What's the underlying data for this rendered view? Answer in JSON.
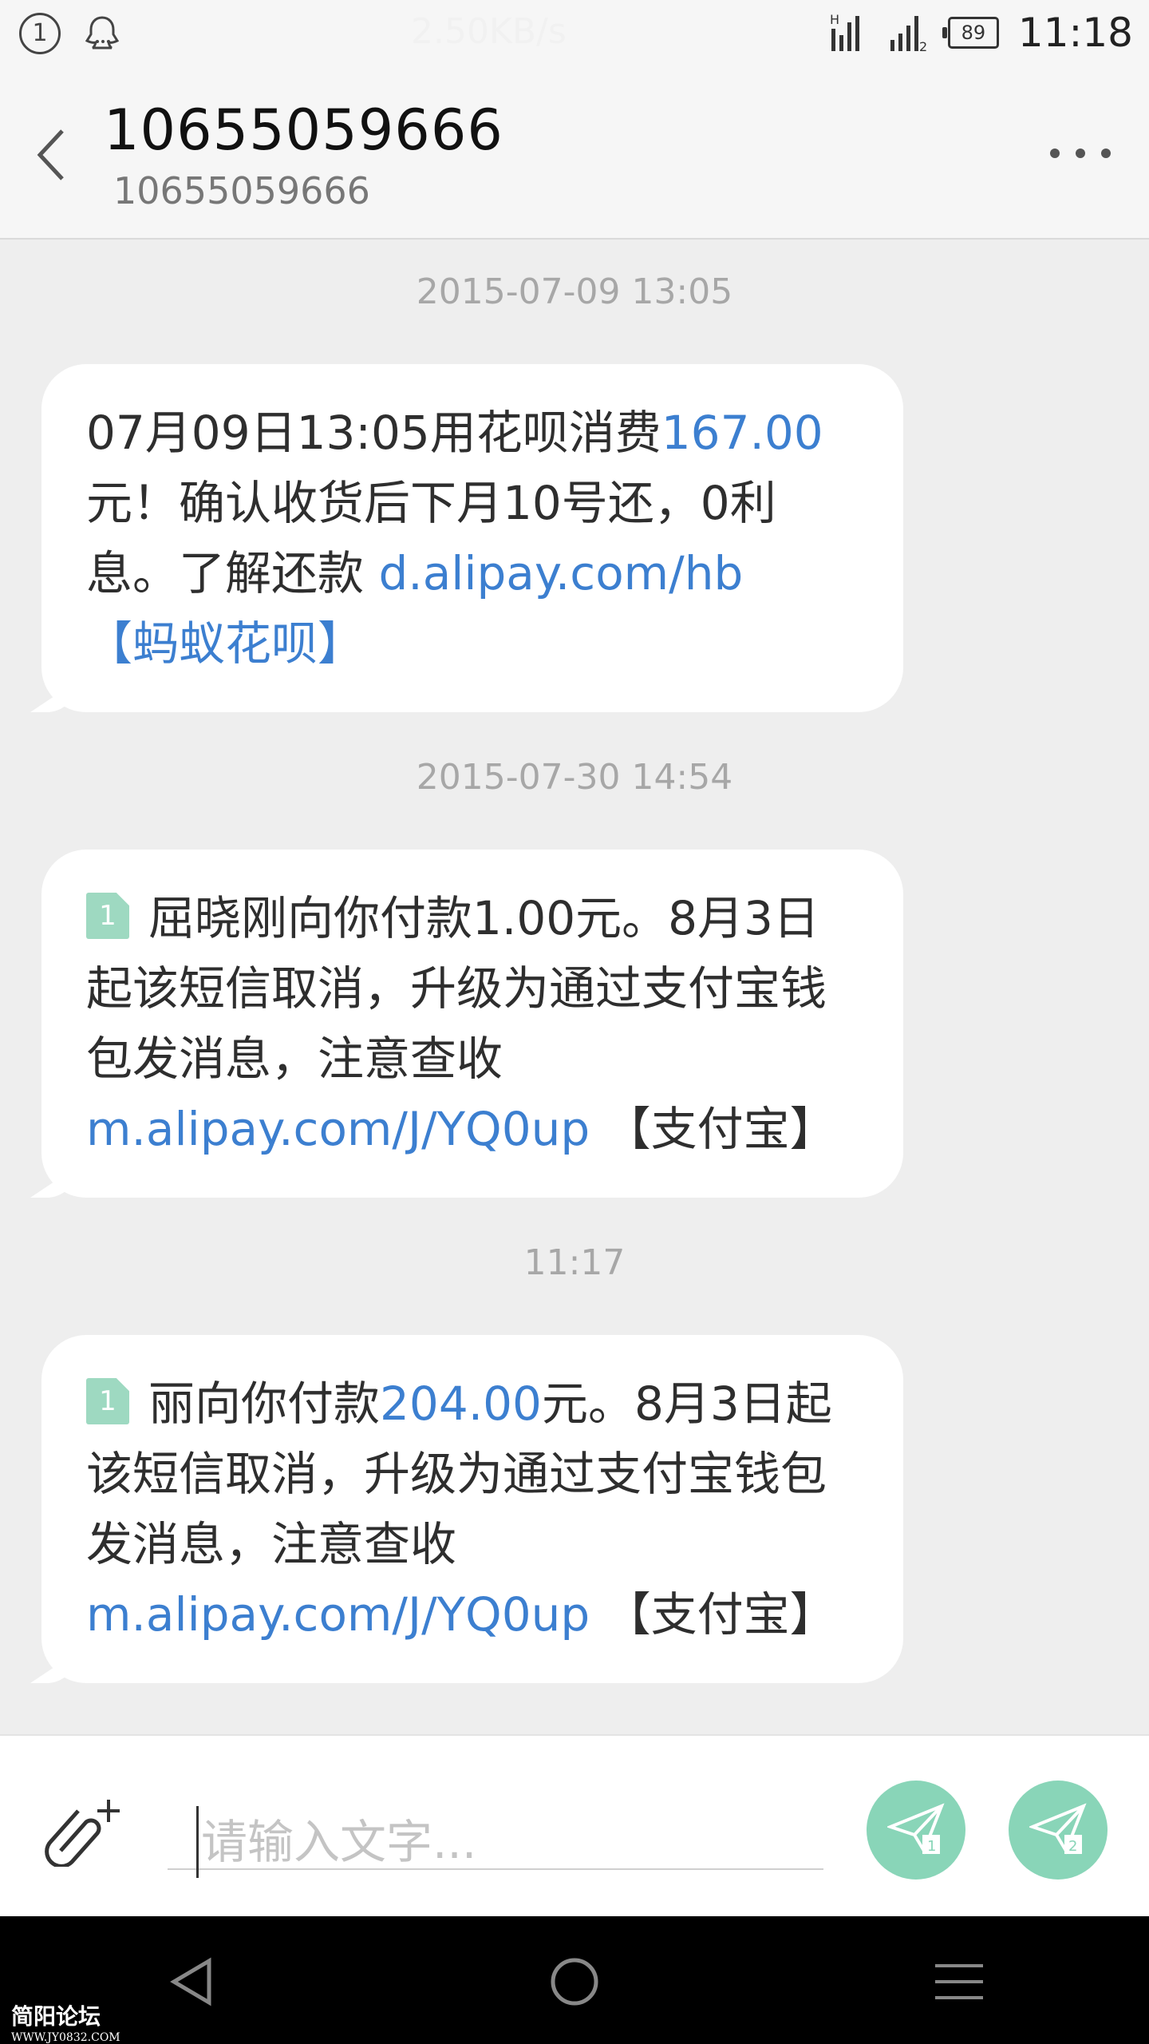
{
  "status_bar": {
    "notification_count": "1",
    "net_speed": "2.50KB/s",
    "signal1_label": "H",
    "signal2_label": "2",
    "battery": "89",
    "time": "11:18"
  },
  "header": {
    "title": "10655059666",
    "subtitle": "10655059666"
  },
  "messages": [
    {
      "timestamp": "2015-07-09  13:05",
      "parts": [
        "07月09日13:05用花呗消费",
        "167.00",
        "元！确认收货后下月10号还，0利息。了解还款 ",
        "d.alipay.com/hb",
        "【蚂蚁花呗】"
      ]
    },
    {
      "timestamp": "2015-07-30  14:54",
      "sim": "1",
      "parts": [
        "屈晓刚向你付款1.00元。8月3日起该短信取消，升级为通过支付宝钱包发消息，注意查收 ",
        "m.alipay.com/J/YQ0up",
        " 【支付宝】"
      ]
    },
    {
      "timestamp": "11:17",
      "sim": "1",
      "parts": [
        "丽向你付款",
        "204.00",
        "元。8月3日起该短信取消，升级为通过支付宝钱包发消息，注意查收 ",
        "m.alipay.com/J/YQ0up",
        " 【支付宝】"
      ]
    }
  ],
  "composer": {
    "placeholder": "请输入文字...",
    "send1_sim": "1",
    "send2_sim": "2"
  },
  "watermark": {
    "name": "简阳论坛",
    "url": "WWW.JY0832.COM"
  },
  "colors": {
    "link": "#3c7fd0",
    "send_button": "#89d5b8",
    "sim_badge": "#9ed9c1"
  }
}
